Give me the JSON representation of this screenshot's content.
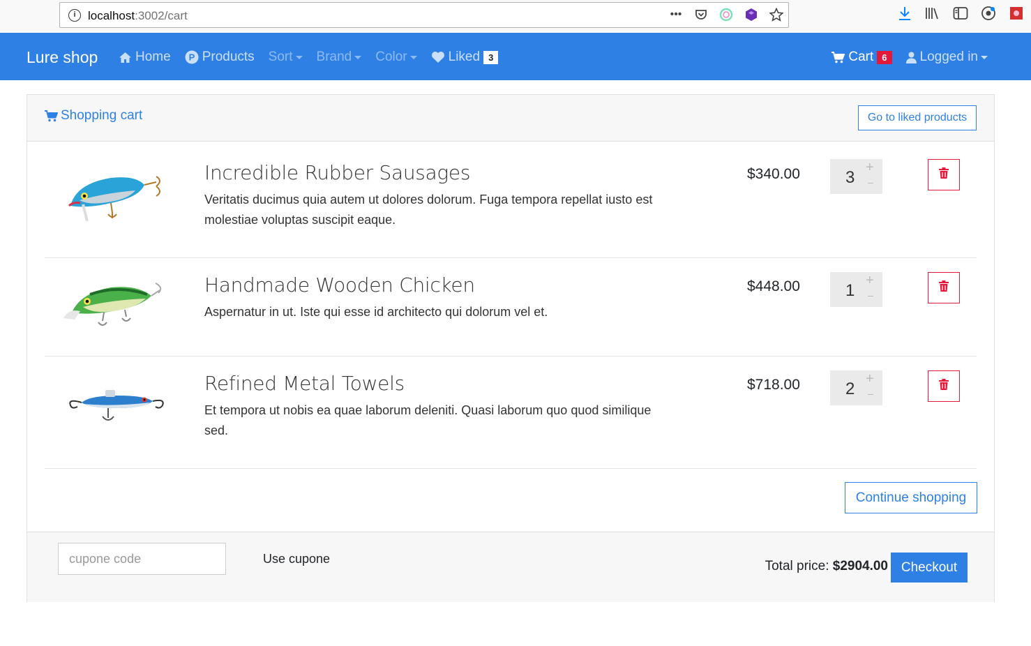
{
  "browser": {
    "url_host": "localhost",
    "url_rest": ":3002/cart"
  },
  "navbar": {
    "brand": "Lure shop",
    "home": "Home",
    "products": "Products",
    "products_icon_letter": "P",
    "sort": "Sort",
    "brand_menu": "Brand",
    "color": "Color",
    "liked": "Liked",
    "liked_count": "3",
    "cart": "Cart",
    "cart_count": "6",
    "user": "Logged in"
  },
  "cart": {
    "title": "Shopping cart",
    "liked_button": "Go to liked products",
    "items": [
      {
        "name": "Incredible Rubber Sausages",
        "description": "Veritatis ducimus quia autem ut dolores dolorum. Fuga tempora repellat iusto est molestiae voluptas suscipit eaque.",
        "price": "$340.00",
        "quantity": "3",
        "plus": "+",
        "minus": "–"
      },
      {
        "name": "Handmade Wooden Chicken",
        "description": "Aspernatur in ut. Iste qui esse id architecto qui dolorum vel et.",
        "price": "$448.00",
        "quantity": "1",
        "plus": "+",
        "minus": "–"
      },
      {
        "name": "Refined Metal Towels",
        "description": "Et tempora ut nobis ea quae laborum deleniti. Quasi laborum quo quod similique sed.",
        "price": "$718.00",
        "quantity": "2",
        "plus": "+",
        "minus": "–"
      }
    ],
    "continue_button": "Continue shopping"
  },
  "footer": {
    "coupon_placeholder": "cupone code",
    "use_coupon": "Use cupone",
    "total_label": "Total price:",
    "total_value": "$2904.00",
    "checkout": "Checkout"
  },
  "colors": {
    "primary": "#2f80e4",
    "danger": "#e3193a"
  }
}
